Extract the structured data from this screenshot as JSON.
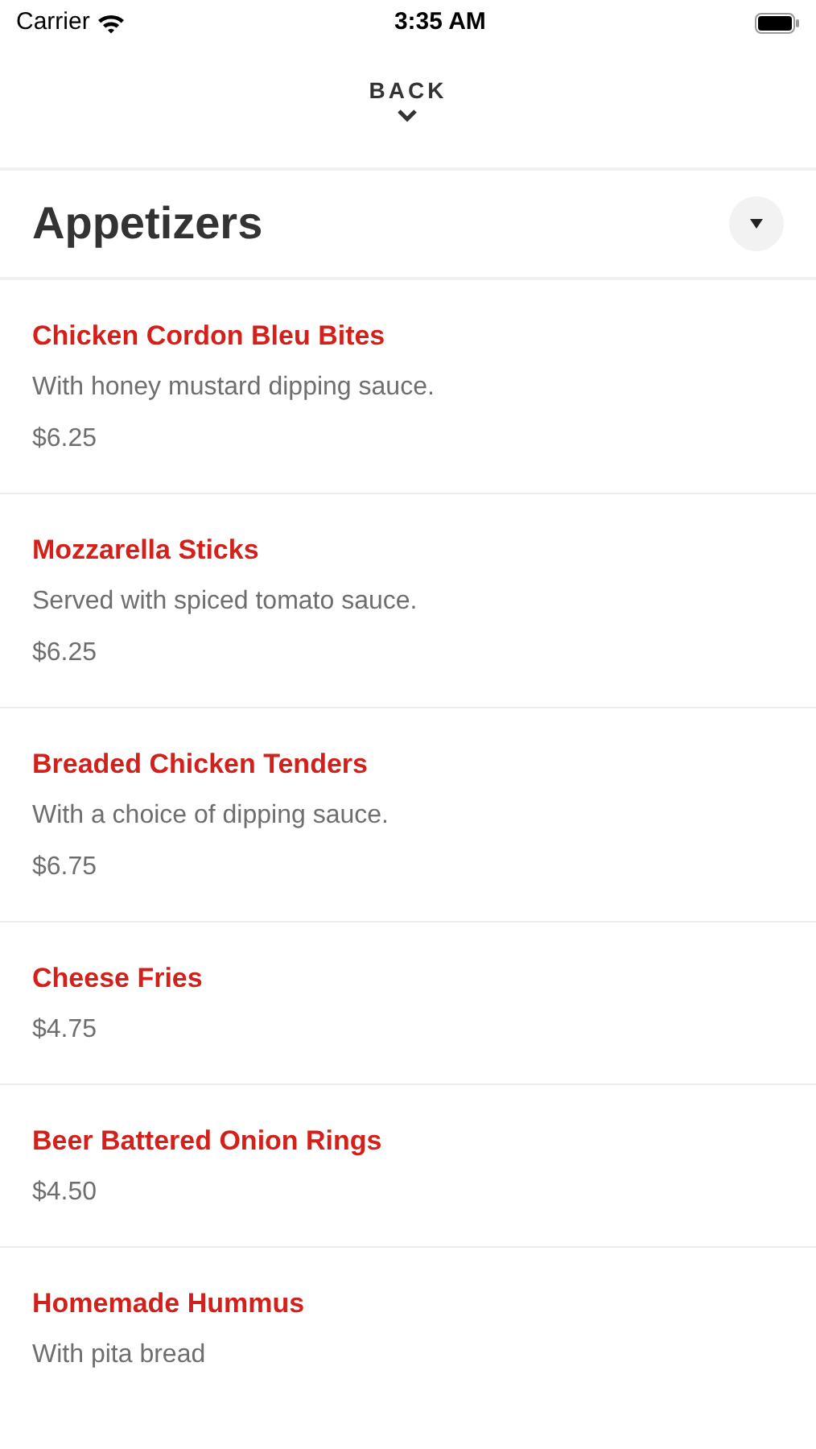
{
  "status_bar": {
    "carrier": "Carrier",
    "time": "3:35 AM"
  },
  "nav": {
    "back_label": "BACK"
  },
  "section": {
    "title": "Appetizers",
    "expanded": true
  },
  "items": [
    {
      "name": "Chicken Cordon Bleu Bites",
      "description": "With honey mustard dipping sauce.",
      "price": "$6.25"
    },
    {
      "name": "Mozzarella Sticks",
      "description": "Served with spiced tomato sauce.",
      "price": "$6.25"
    },
    {
      "name": "Breaded Chicken Tenders",
      "description": "With a choice of dipping sauce.",
      "price": "$6.75"
    },
    {
      "name": "Cheese Fries",
      "price": "$4.75"
    },
    {
      "name": "Beer Battered Onion Rings",
      "price": "$4.50"
    },
    {
      "name": "Homemade Hummus",
      "description": "With pita bread"
    }
  ]
}
